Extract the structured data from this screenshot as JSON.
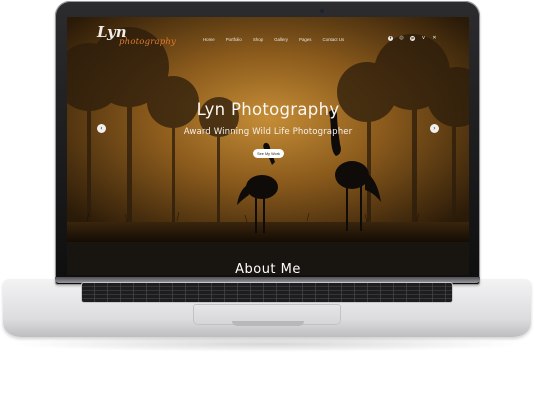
{
  "site": {
    "logo_main": "Lyn",
    "logo_sub": "photography",
    "nav": [
      "Home",
      "Portfolio",
      "Shop",
      "Gallery",
      "Pages",
      "Contact Us"
    ],
    "social_icons": [
      "facebook-icon",
      "instagram-icon",
      "pinterest-icon",
      "vimeo-icon",
      "x-icon"
    ]
  },
  "hero": {
    "title": "Lyn Photography",
    "subtitle": "Award Winning Wild Life Photographer",
    "button": "See My Work",
    "prev": "‹",
    "next": "›"
  },
  "about": {
    "heading": "About Me"
  },
  "colors": {
    "sky_top": "#3a2710",
    "sky_mid": "#b07a2a",
    "logo_accent": "#e07a2c"
  }
}
